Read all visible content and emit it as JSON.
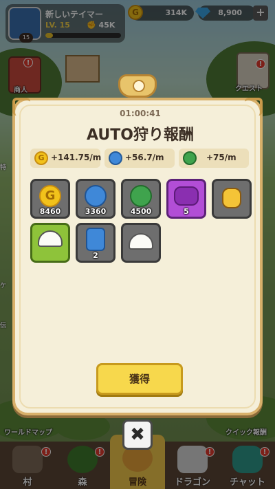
{
  "profile": {
    "name": "新しいテイマー",
    "level_label": "LV. 15",
    "power": "45K",
    "avatar_level": "15",
    "exp_fraction": 0.1
  },
  "resources": {
    "gold": "314K",
    "gems": "8,900",
    "plus": "+"
  },
  "side_left": {
    "shop_label": "商人",
    "mini_labels": [
      "特",
      "ケ",
      "伝"
    ]
  },
  "side_right": {
    "quest_label": "クエスト"
  },
  "alert_mark": "!",
  "footer_labels": {
    "world_map": "ワールドマップ",
    "quick_reward": "クイック報酬"
  },
  "bottom_nav": [
    {
      "label": "村",
      "active": false
    },
    {
      "label": "森",
      "active": false
    },
    {
      "label": "冒険",
      "active": true
    },
    {
      "label": "ドラゴン",
      "active": false
    },
    {
      "label": "チャット",
      "active": false
    }
  ],
  "modal": {
    "timer": "01:00:41",
    "title": "AUTO狩り報酬",
    "rates": [
      {
        "icon": "gold-coin-icon",
        "value": "+141.75/m"
      },
      {
        "icon": "blue-pet-icon",
        "value": "+56.7/m"
      },
      {
        "icon": "exp-icon",
        "value": "+75/m"
      }
    ],
    "items": [
      {
        "icon": "gold-coin-icon",
        "count": "8460",
        "rarity": "gray"
      },
      {
        "icon": "blue-pet-orb-icon",
        "count": "3360",
        "rarity": "gray"
      },
      {
        "icon": "exp-orb-icon",
        "count": "4500",
        "rarity": "gray"
      },
      {
        "icon": "purple-gem-icon",
        "count": "5",
        "rarity": "purple"
      },
      {
        "icon": "pacifier-icon",
        "count": "",
        "rarity": "gray"
      },
      {
        "icon": "white-helmet-icon",
        "count": "",
        "rarity": "green"
      },
      {
        "icon": "blue-armor-icon",
        "count": "2",
        "rarity": "gray"
      },
      {
        "icon": "white-cap-icon",
        "count": "",
        "rarity": "gray"
      }
    ],
    "obtain_label": "獲得",
    "close_label": "✖"
  },
  "colors": {
    "modal_bg": "#f5efd9",
    "modal_border": "#d8b06a",
    "obtain_button": "#f7d84c",
    "purple_rarity": "#b24ed6",
    "green_rarity": "#8ec33a",
    "gold": "#f2c21b",
    "gem": "#3aa4e6"
  }
}
